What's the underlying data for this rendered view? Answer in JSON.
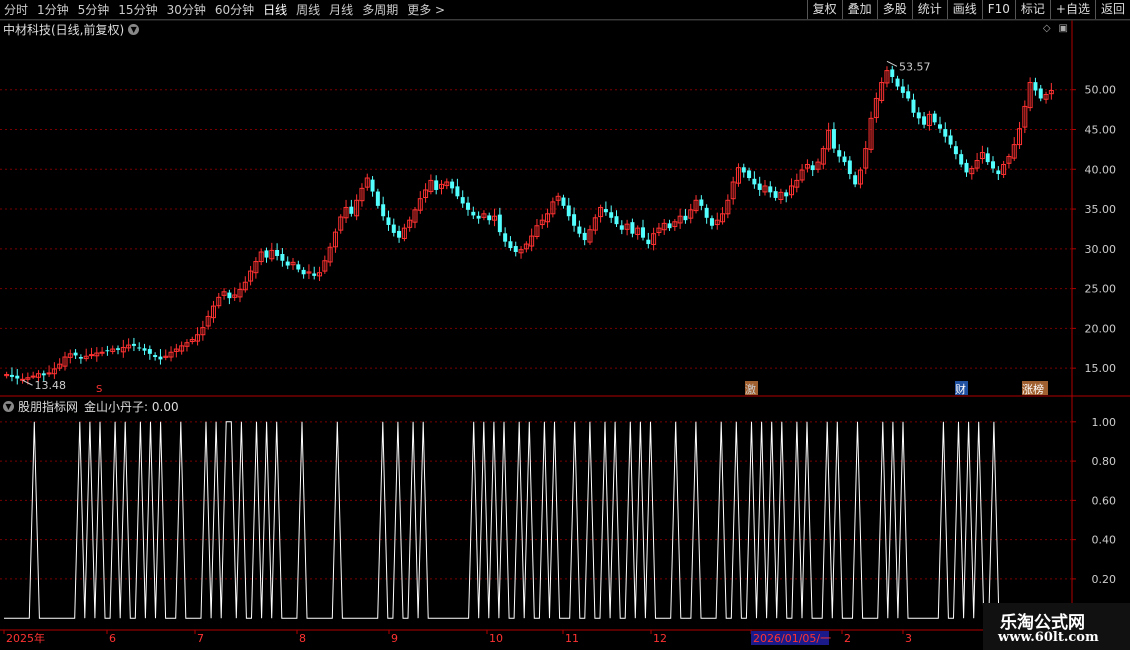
{
  "toolbar": {
    "periods": [
      "分时",
      "1分钟",
      "5分钟",
      "15分钟",
      "30分钟",
      "60分钟",
      "日线",
      "周线",
      "月线",
      "多周期",
      "更多 >"
    ],
    "active_period": "日线",
    "buttons": [
      "复权",
      "叠加",
      "多股",
      "统计",
      "画线",
      "F10",
      "标记",
      "+自选",
      "返回"
    ]
  },
  "stock_title": "中材科技(日线,前复权)",
  "indicator": {
    "source": "股朋指标网",
    "name_value": "金山小丹子: 0.00"
  },
  "markers": {
    "s": "S",
    "activity": "激",
    "finance": "财",
    "limit_up": "涨榜"
  },
  "price_annotations": {
    "high": "53.57",
    "low": "13.48"
  },
  "date_labels": [
    "2025年",
    "6",
    "7",
    "8",
    "9",
    "10",
    "11",
    "12",
    "2026/01/05/一",
    "2",
    "3"
  ],
  "watermark": {
    "line1": "乐淘公式网",
    "line2": "www.60lt.com"
  },
  "colors": {
    "up": "#ff3232",
    "down": "#54ffff",
    "grid": "#7a0000",
    "axis": "#b00000",
    "text": "#cccccc"
  },
  "chart_data": [
    {
      "type": "candlestick",
      "title": "中材科技(日线,前复权)",
      "y_ticks": [
        "15.00",
        "20.00",
        "25.00",
        "30.00",
        "35.00",
        "40.00",
        "45.00",
        "50.00"
      ],
      "ylim": [
        11.5,
        56.5
      ],
      "grid": true,
      "high_label": 53.57,
      "low_label": 13.48,
      "closes": [
        14.2,
        13.9,
        13.7,
        13.6,
        13.8,
        14.0,
        14.3,
        14.1,
        14.4,
        14.9,
        15.5,
        16.4,
        16.8,
        16.6,
        16.2,
        16.5,
        16.7,
        16.9,
        17.0,
        17.2,
        17.4,
        17.3,
        17.6,
        17.9,
        17.8,
        17.5,
        17.2,
        16.8,
        16.4,
        16.1,
        16.5,
        17.0,
        17.4,
        17.8,
        18.2,
        18.6,
        19.2,
        20.1,
        21.5,
        22.8,
        23.9,
        24.6,
        23.8,
        24.2,
        24.9,
        25.8,
        27.2,
        28.4,
        29.6,
        28.9,
        29.8,
        29.1,
        28.5,
        27.9,
        28.3,
        27.4,
        26.8,
        27.1,
        26.6,
        27.0,
        28.5,
        30.2,
        32.1,
        34.0,
        35.2,
        34.4,
        36.1,
        37.6,
        38.9,
        37.2,
        35.4,
        34.1,
        33.0,
        32.0,
        31.4,
        32.6,
        33.6,
        34.9,
        36.3,
        37.4,
        38.6,
        37.4,
        38.1,
        38.4,
        37.6,
        36.6,
        35.7,
        34.9,
        34.2,
        33.8,
        34.4,
        33.6,
        34.1,
        32.1,
        30.9,
        30.1,
        29.6,
        29.9,
        30.6,
        31.6,
        32.9,
        33.6,
        34.4,
        35.9,
        36.6,
        35.4,
        34.1,
        32.9,
        31.9,
        31.1,
        32.4,
        33.9,
        35.2,
        34.6,
        33.9,
        33.1,
        32.4,
        33.1,
        31.9,
        32.6,
        31.4,
        30.6,
        31.9,
        32.6,
        33.2,
        32.6,
        33.4,
        34.1,
        33.6,
        34.9,
        36.1,
        35.4,
        33.9,
        32.9,
        33.6,
        34.4,
        36.1,
        38.4,
        40.2,
        39.6,
        38.9,
        38.1,
        37.4,
        37.9,
        37.1,
        36.4,
        37.1,
        36.6,
        37.9,
        38.6,
        39.9,
        40.6,
        39.9,
        40.9,
        42.6,
        44.9,
        42.6,
        41.6,
        40.9,
        39.4,
        38.1,
        39.9,
        42.6,
        46.4,
        48.9,
        50.9,
        52.4,
        51.6,
        50.4,
        49.6,
        48.9,
        47.1,
        46.4,
        45.6,
        46.9,
        45.9,
        45.1,
        44.1,
        43.1,
        41.9,
        40.6,
        39.6,
        40.1,
        41.1,
        42.1,
        40.9,
        40.1,
        39.4,
        40.6,
        41.6,
        43.1,
        45.1,
        47.9,
        50.9,
        49.9,
        48.9,
        49.4,
        49.9
      ]
    },
    {
      "type": "line",
      "title": "金山小丹子",
      "y_ticks": [
        "0.20",
        "0.40",
        "0.60",
        "0.80",
        "1.00"
      ],
      "ylim": [
        -0.05,
        1.05
      ],
      "values": [
        0,
        0,
        0,
        0,
        0,
        0,
        1,
        0,
        0,
        0,
        0,
        0,
        0,
        0,
        0,
        1,
        0,
        1,
        0,
        1,
        0,
        0,
        1,
        0,
        1,
        0,
        0,
        1,
        0,
        1,
        0,
        1,
        0,
        0,
        0,
        1,
        0,
        0,
        0,
        0,
        1,
        0,
        1,
        0,
        1,
        1,
        0,
        1,
        0,
        0,
        1,
        0,
        1,
        0,
        1,
        0,
        0,
        0,
        0,
        1,
        0,
        0,
        0,
        0,
        0,
        0,
        1,
        0,
        0,
        0,
        0,
        0,
        0,
        0,
        0,
        1,
        0,
        0,
        1,
        0,
        0,
        1,
        0,
        1,
        0,
        0,
        0,
        0,
        0,
        0,
        0,
        0,
        0,
        1,
        0,
        1,
        0,
        1,
        0,
        1,
        0,
        0,
        1,
        0,
        1,
        0,
        0,
        1,
        0,
        1,
        0,
        0,
        0,
        1,
        0,
        0,
        1,
        0,
        0,
        1,
        0,
        1,
        0,
        0,
        1,
        0,
        1,
        0,
        1,
        0,
        0,
        0,
        0,
        1,
        0,
        0,
        0,
        1,
        0,
        0,
        0,
        0,
        1,
        0,
        0,
        1,
        0,
        0,
        1,
        0,
        1,
        0,
        1,
        0,
        1,
        0,
        0,
        1,
        0,
        1,
        0,
        0,
        0,
        1,
        0,
        1,
        0,
        0,
        0,
        1,
        0,
        0,
        0,
        0,
        1,
        0,
        1,
        0,
        1,
        0,
        0,
        0,
        0,
        0,
        0,
        0,
        1,
        0,
        0,
        1,
        0,
        1,
        0,
        1,
        0,
        0,
        1,
        0
      ]
    }
  ]
}
